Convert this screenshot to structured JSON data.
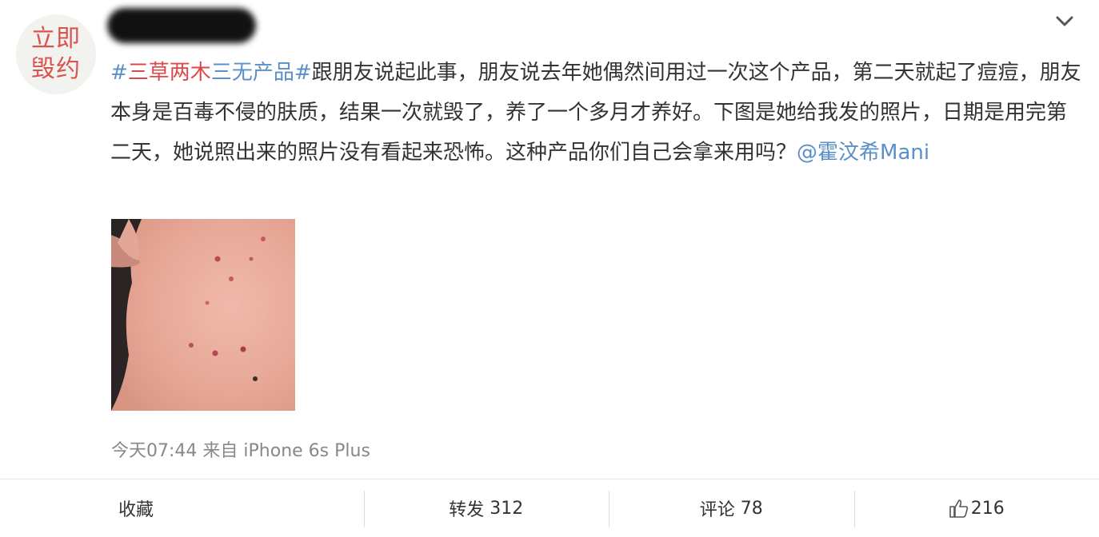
{
  "avatar": {
    "line1": "立即",
    "line2": "毁约"
  },
  "post": {
    "topic_hash_open": "#",
    "topic_part1": "三草两木",
    "topic_part2": "三无产品",
    "topic_hash_close": "#",
    "body": "跟朋友说起此事，朋友说去年她偶然间用过一次这个产品，第二天就起了痘痘，朋友本身是百毒不侵的肤质，结果一次就毁了，养了一个多月才养好。下图是她给我发的照片，日期是用完第二天，她说照出来的照片没有看起来恐怖。这种产品你们自己会拿来用吗？",
    "mention": "@霍汶希Mani"
  },
  "meta": {
    "time": "今天07:44",
    "from_label": "来自",
    "device": "iPhone 6s Plus"
  },
  "actions": {
    "favorite": "收藏",
    "repost_label": "转发",
    "repost_count": "312",
    "comment_label": "评论",
    "comment_count": "78",
    "like_count": "216"
  },
  "colors": {
    "link": "#5a8fc8",
    "topic_red": "#e0454a",
    "meta": "#888888"
  },
  "icons": {
    "menu": "chevron-down-icon",
    "like": "thumbs-up-icon"
  }
}
